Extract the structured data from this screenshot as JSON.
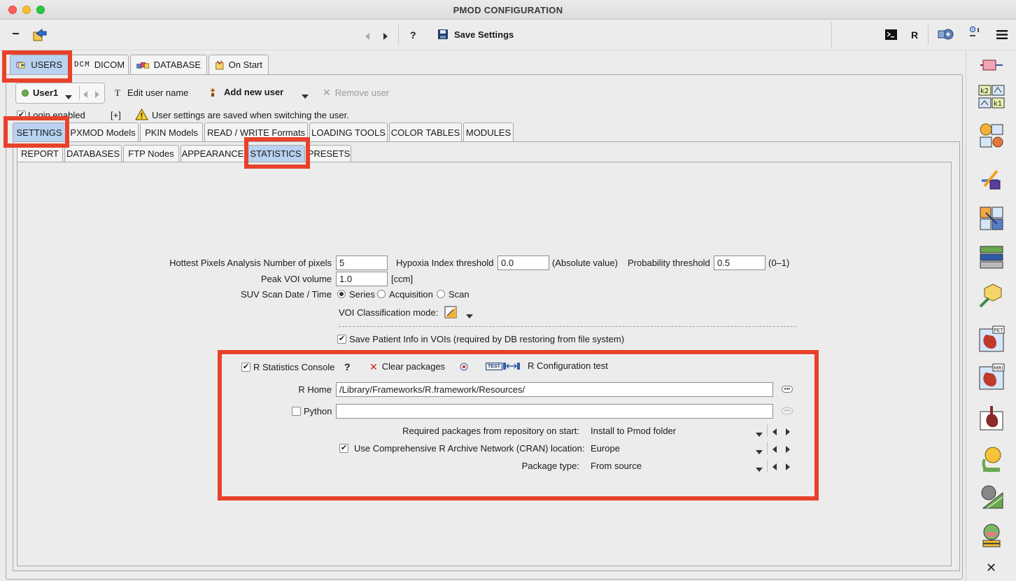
{
  "window": {
    "title": "PMOD CONFIGURATION"
  },
  "toolbar": {
    "help": "?",
    "save_settings": "Save Settings",
    "r_label": "R"
  },
  "top_tabs": [
    {
      "label": "USERS"
    },
    {
      "label": "DICOM",
      "prefix": "DCM"
    },
    {
      "label": "DATABASE"
    },
    {
      "label": "On Start"
    }
  ],
  "user_bar": {
    "user": "User1",
    "edit_user_name": "Edit user name",
    "edit_prefix": "T",
    "add_new_user": "Add new user",
    "remove_user": "Remove user",
    "login_enabled": "Login enabled",
    "expand": "[+]",
    "warning": "User settings are saved when switching the user."
  },
  "settings_tabs": [
    {
      "label": "SETTINGS"
    },
    {
      "label": "PXMOD Models"
    },
    {
      "label": "PKIN Models"
    },
    {
      "label": "READ / WRITE Formats"
    },
    {
      "label": "LOADING TOOLS"
    },
    {
      "label": "COLOR TABLES"
    },
    {
      "label": "MODULES"
    }
  ],
  "sub_tabs": [
    {
      "label": "REPORT"
    },
    {
      "label": "DATABASES"
    },
    {
      "label": "FTP Nodes"
    },
    {
      "label": "APPEARANCE"
    },
    {
      "label": "STATISTICS"
    },
    {
      "label": "PRESETS"
    }
  ],
  "statistics": {
    "hottest_label": "Hottest Pixels Analysis Number of pixels",
    "hottest_value": "5",
    "hypoxia_label": "Hypoxia Index threshold",
    "hypoxia_value": "0.0",
    "hypoxia_unit": "(Absolute value)",
    "probability_label": "Probability threshold",
    "probability_value": "0.5",
    "probability_unit": "(0–1)",
    "peak_label": "Peak VOI volume",
    "peak_value": "1.0",
    "peak_unit": "[ccm]",
    "suv_label": "SUV Scan Date / Time",
    "suv_options": [
      "Series",
      "Acquisition",
      "Scan"
    ],
    "suv_selected": "Series",
    "voi_class_label": "VOI Classification mode:",
    "save_patient_info": "Save Patient Info in VOIs (required by DB restoring from file system)"
  },
  "r_section": {
    "console_label": "R Statistics Console",
    "help": "?",
    "clear_packages": "Clear packages",
    "config_test": "R Configuration test",
    "test_badge": "TEST",
    "r_home_label": "R Home",
    "r_home_value": "/Library/Frameworks/R.framework/Resources/",
    "python_label": "Python",
    "python_value": "",
    "required_label": "Required packages from repository on start:",
    "required_value": "Install to Pmod folder",
    "cran_label": "Use Comprehensive R Archive Network (CRAN) location:",
    "cran_value": "Europe",
    "pkg_type_label": "Package type:",
    "pkg_type_value": "From source"
  },
  "sidebar": {
    "pet": "PET",
    "mri": "MRI",
    "k2": "k2",
    "k1": "k1"
  },
  "colors": {
    "highlight_red": "#e8412c",
    "tab_selected": "#b8d2f0"
  }
}
